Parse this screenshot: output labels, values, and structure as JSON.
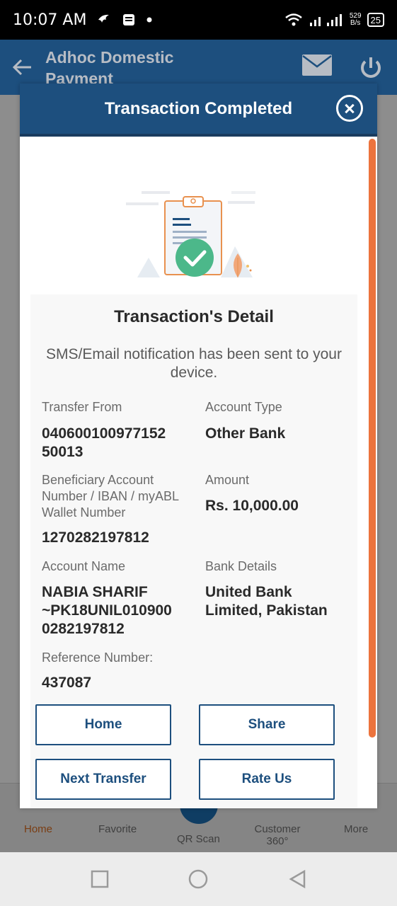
{
  "status_bar": {
    "time": "10:07 AM",
    "net_speed_value": "529",
    "net_speed_unit": "B/s",
    "battery": "25"
  },
  "app_bar": {
    "title_line1": "Adhoc Domestic",
    "title_line2": "Payment"
  },
  "modal": {
    "title": "Transaction Completed",
    "card_title": "Transaction's Detail",
    "notice": "SMS/Email notification has been sent to your device.",
    "fields": {
      "transfer_from_label": "Transfer From",
      "transfer_from_value": "040600100977152 50013",
      "account_type_label": "Account Type",
      "account_type_value": "Other Bank",
      "beneficiary_label": "Beneficiary Account Number / IBAN / myABL Wallet Number",
      "beneficiary_value": "1270282197812",
      "amount_label": "Amount",
      "amount_value": "Rs. 10,000.00",
      "account_name_label": "Account Name",
      "account_name_value": "NABIA SHARIF ~PK18UNIL010900 0282197812",
      "bank_details_label": "Bank Details",
      "bank_details_value": "United Bank Limited, Pakistan",
      "reference_label": "Reference Number:",
      "reference_value": "437087"
    },
    "buttons": {
      "home": "Home",
      "share": "Share",
      "next_transfer": "Next Transfer",
      "rate_us": "Rate Us"
    },
    "colors": {
      "primary": "#1d4f7e",
      "scroll_accent": "#ec733d",
      "success": "#4cb88a"
    }
  },
  "bottom_nav": {
    "items": [
      "Home",
      "Favorite",
      "QR Scan",
      "Customer 360°",
      "More"
    ]
  }
}
